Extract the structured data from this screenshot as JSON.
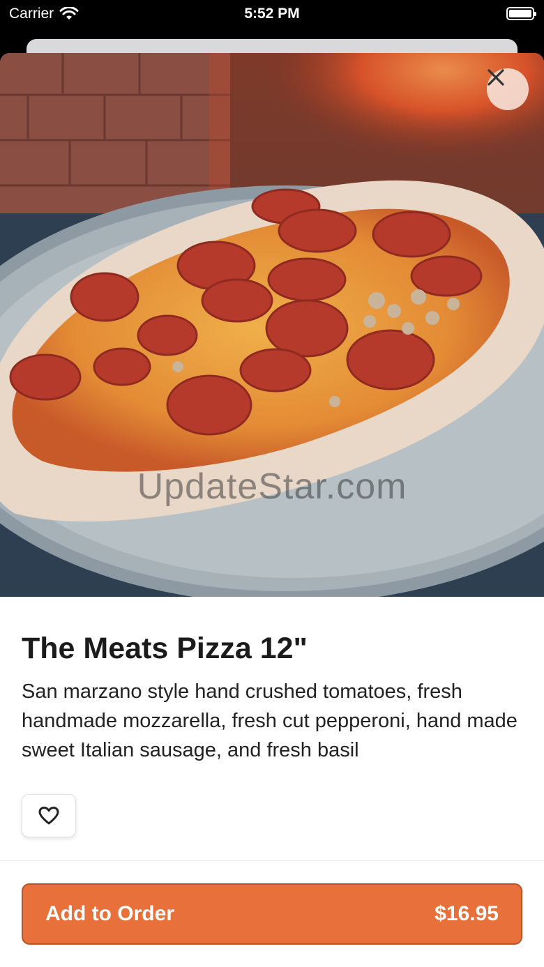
{
  "status_bar": {
    "carrier": "Carrier",
    "time": "5:52 PM"
  },
  "item": {
    "image_icon": "pizza-photo",
    "watermark": "UpdateStar.com",
    "title": "The Meats Pizza 12\"",
    "description": "San marzano style hand crushed tomatoes, fresh handmade mozzarella, fresh cut pepperoni, hand made sweet Italian sausage, and fresh basil"
  },
  "actions": {
    "close_icon": "close-icon",
    "favorite_icon": "heart-outline-icon",
    "add_to_order_label": "Add to Order",
    "price": "$16.95"
  },
  "colors": {
    "accent": "#e8703a",
    "accent_border": "#b8532a",
    "title_text": "#1b1b1b",
    "close_button_bg": "#f5ded2"
  }
}
